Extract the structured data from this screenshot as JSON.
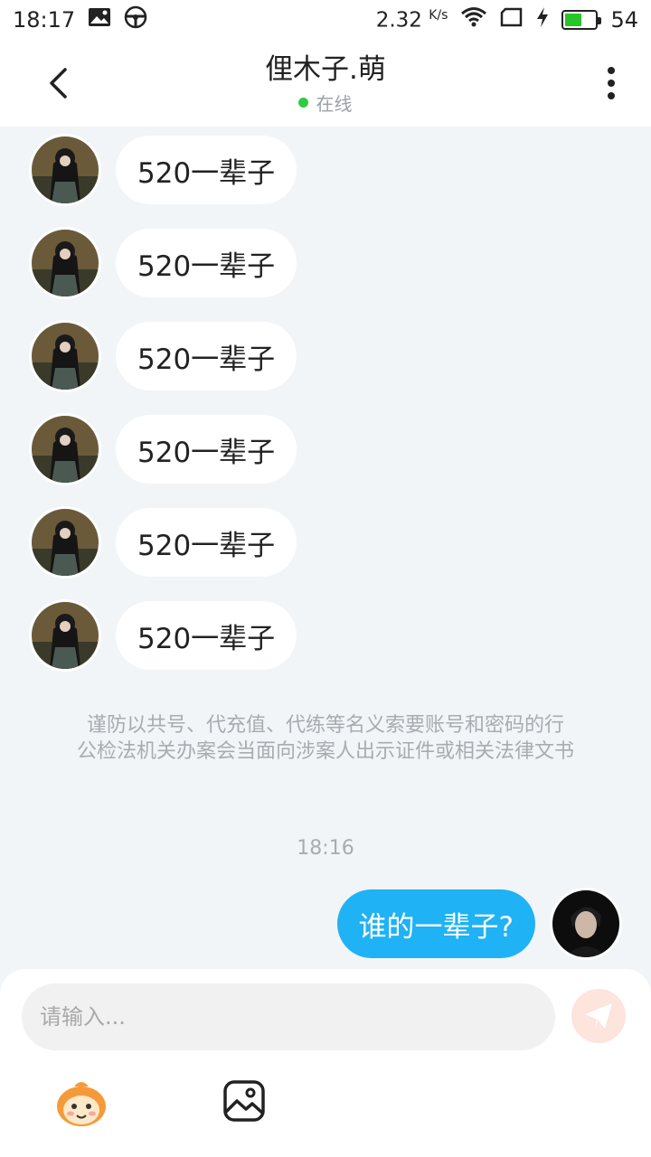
{
  "status_bar": {
    "time": "18:17",
    "net_speed": "2.32",
    "net_unit": "K/s",
    "battery": "54",
    "battery_level": 0.54,
    "icons": [
      "image-icon",
      "steering-wheel-icon",
      "wifi-icon",
      "screen-icon",
      "charging-icon",
      "battery-icon"
    ]
  },
  "header": {
    "title": "俚木子.萌",
    "presence": "在线",
    "presence_color": "#2ecc40"
  },
  "messages": {
    "incoming": [
      {
        "text": "520一辈子"
      },
      {
        "text": "520一辈子"
      },
      {
        "text": "520一辈子"
      },
      {
        "text": "520一辈子"
      },
      {
        "text": "520一辈子"
      },
      {
        "text": "520一辈子"
      }
    ],
    "notice_line1": "谨防以共号、代充值、代练等名义索要账号和密码的行",
    "notice_line2": "公检法机关办案会当面向涉案人出示证件或相关法律文书",
    "timestamp": "18:16",
    "outgoing": {
      "text": "谁的一辈子?"
    }
  },
  "composer": {
    "placeholder": "请输入...",
    "value": ""
  },
  "colors": {
    "accent": "#1fb2f5",
    "background": "#f1f5f7",
    "send_button": "#fde4dc"
  }
}
